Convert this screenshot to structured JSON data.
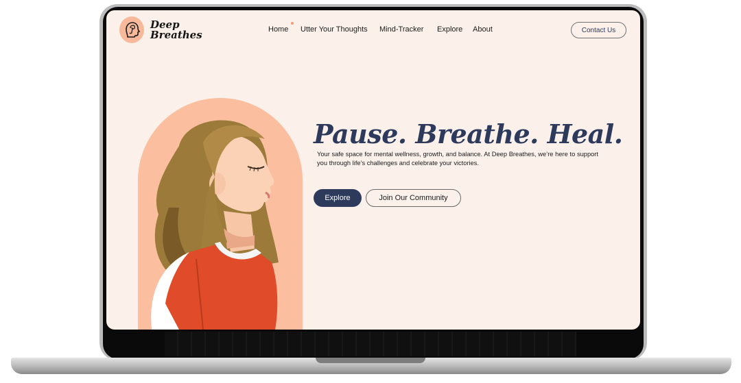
{
  "brand": {
    "line1": "Deep",
    "line2": "Breathes"
  },
  "nav": {
    "items": [
      {
        "label": "Home"
      },
      {
        "label": "Utter Your Thoughts"
      },
      {
        "label": "Mind-Tracker"
      },
      {
        "label": "Explore"
      },
      {
        "label": "About"
      }
    ],
    "contact_label": "Contact Us"
  },
  "hero": {
    "headline": "Pause. Breathe. Heal.",
    "tagline": "Your safe space for mental wellness, growth, and balance. At Deep Breathes, we’re here to support you through life’s challenges and celebrate your victories.",
    "primary_button": "Explore",
    "secondary_button": "Join Our Community"
  },
  "colors": {
    "background": "#fbf1ea",
    "accent_navy": "#2d3a5c",
    "peach": "#fbbf9f"
  },
  "icons": {
    "logo": "head-brain-icon"
  }
}
